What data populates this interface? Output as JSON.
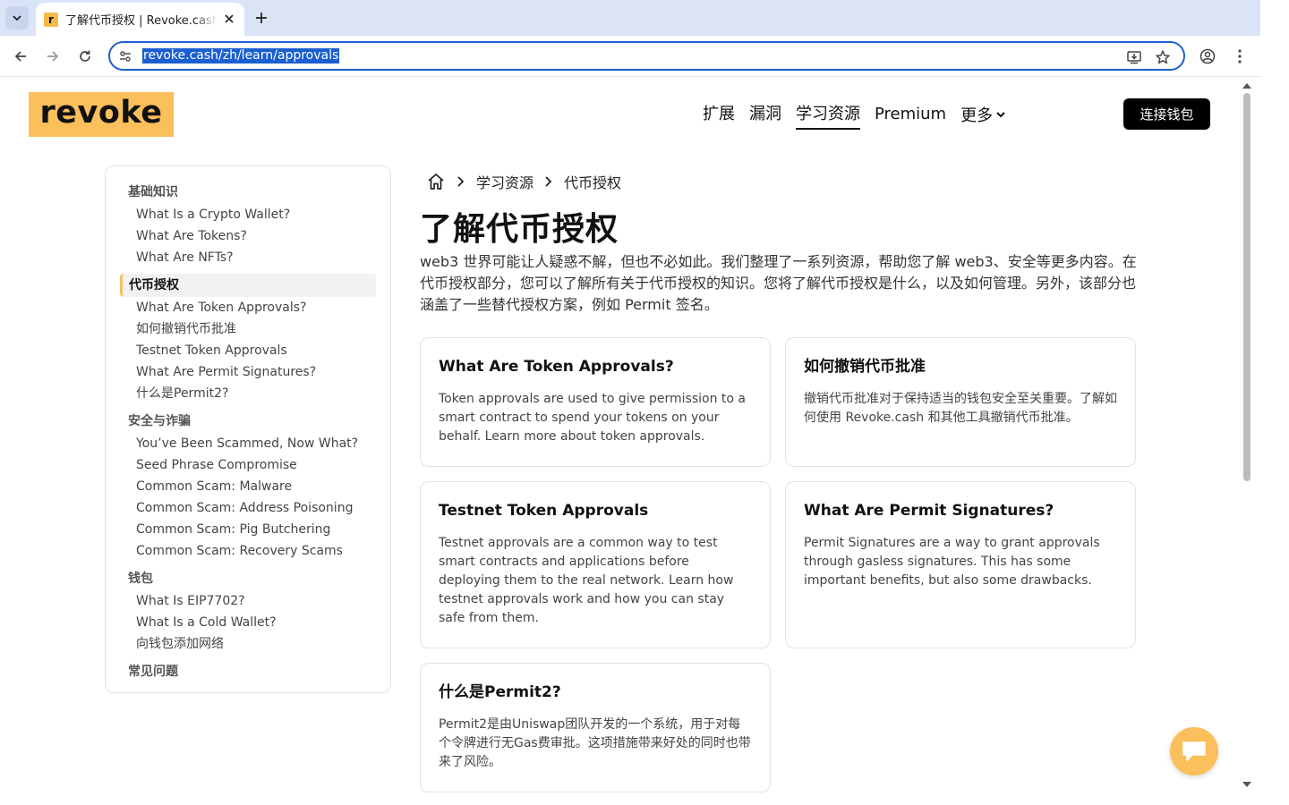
{
  "browser": {
    "tab_title": "了解代币授权 | Revoke.cash",
    "favicon_letter": "r",
    "url": "revoke.cash/zh/learn/approvals"
  },
  "header": {
    "logo": "revoke",
    "nav": [
      "扩展",
      "漏洞",
      "学习资源",
      "Premium"
    ],
    "more_label": "更多",
    "connect_label": "连接钱包"
  },
  "sidebar": {
    "sections": [
      {
        "title": "基础知识",
        "items": [
          "What Is a Crypto Wallet?",
          "What Are Tokens?",
          "What Are NFTs?"
        ]
      },
      {
        "title": "代币授权",
        "items": [
          "What Are Token Approvals?",
          "如何撤销代币批准",
          "Testnet Token Approvals",
          "What Are Permit Signatures?",
          "什么是Permit2?"
        ]
      },
      {
        "title": "安全与诈骗",
        "items": [
          "You’ve Been Scammed, Now What?",
          "Seed Phrase Compromise",
          "Common Scam: Malware",
          "Common Scam: Address Poisoning",
          "Common Scam: Pig Butchering",
          "Common Scam: Recovery Scams"
        ]
      },
      {
        "title": "钱包",
        "items": [
          "What Is EIP7702?",
          "What Is a Cold Wallet?",
          "向钱包添加网络"
        ]
      },
      {
        "title": "常见问题",
        "items": []
      }
    ]
  },
  "main": {
    "breadcrumb": [
      "学习资源",
      "代币授权"
    ],
    "title": "了解代币授权",
    "intro": "web3 世界可能让人疑惑不解，但也不必如此。我们整理了一系列资源，帮助您了解 web3、安全等更多内容。在代币授权部分，您可以了解所有关于代币授权的知识。您将了解代币授权是什么，以及如何管理。另外，该部分也涵盖了一些替代授权方案，例如 Permit 签名。",
    "cards": [
      {
        "title": "What Are Token Approvals?",
        "desc": "Token approvals are used to give permission to a smart contract to spend your tokens on your behalf. Learn more about token approvals."
      },
      {
        "title": "如何撤销代币批准",
        "desc": "撤销代币批准对于保持适当的钱包安全至关重要。了解如何使用 Revoke.cash 和其他工具撤销代币批准。"
      },
      {
        "title": "Testnet Token Approvals",
        "desc": "Testnet approvals are a common way to test smart contracts and applications before deploying them to the real network. Learn how testnet approvals work and how you can stay safe from them."
      },
      {
        "title": "What Are Permit Signatures?",
        "desc": "Permit Signatures are a way to grant approvals through gasless signatures. This has some important benefits, but also some drawbacks."
      },
      {
        "title": "什么是Permit2?",
        "desc": "Permit2是由Uniswap团队开发的一个系统，用于对每个令牌进行无Gas费审批。这项措施带来好处的同时也带来了风险。"
      }
    ]
  },
  "colors": {
    "brand": "#fbbf5b",
    "omnibox_focus": "#1a5fd1"
  }
}
